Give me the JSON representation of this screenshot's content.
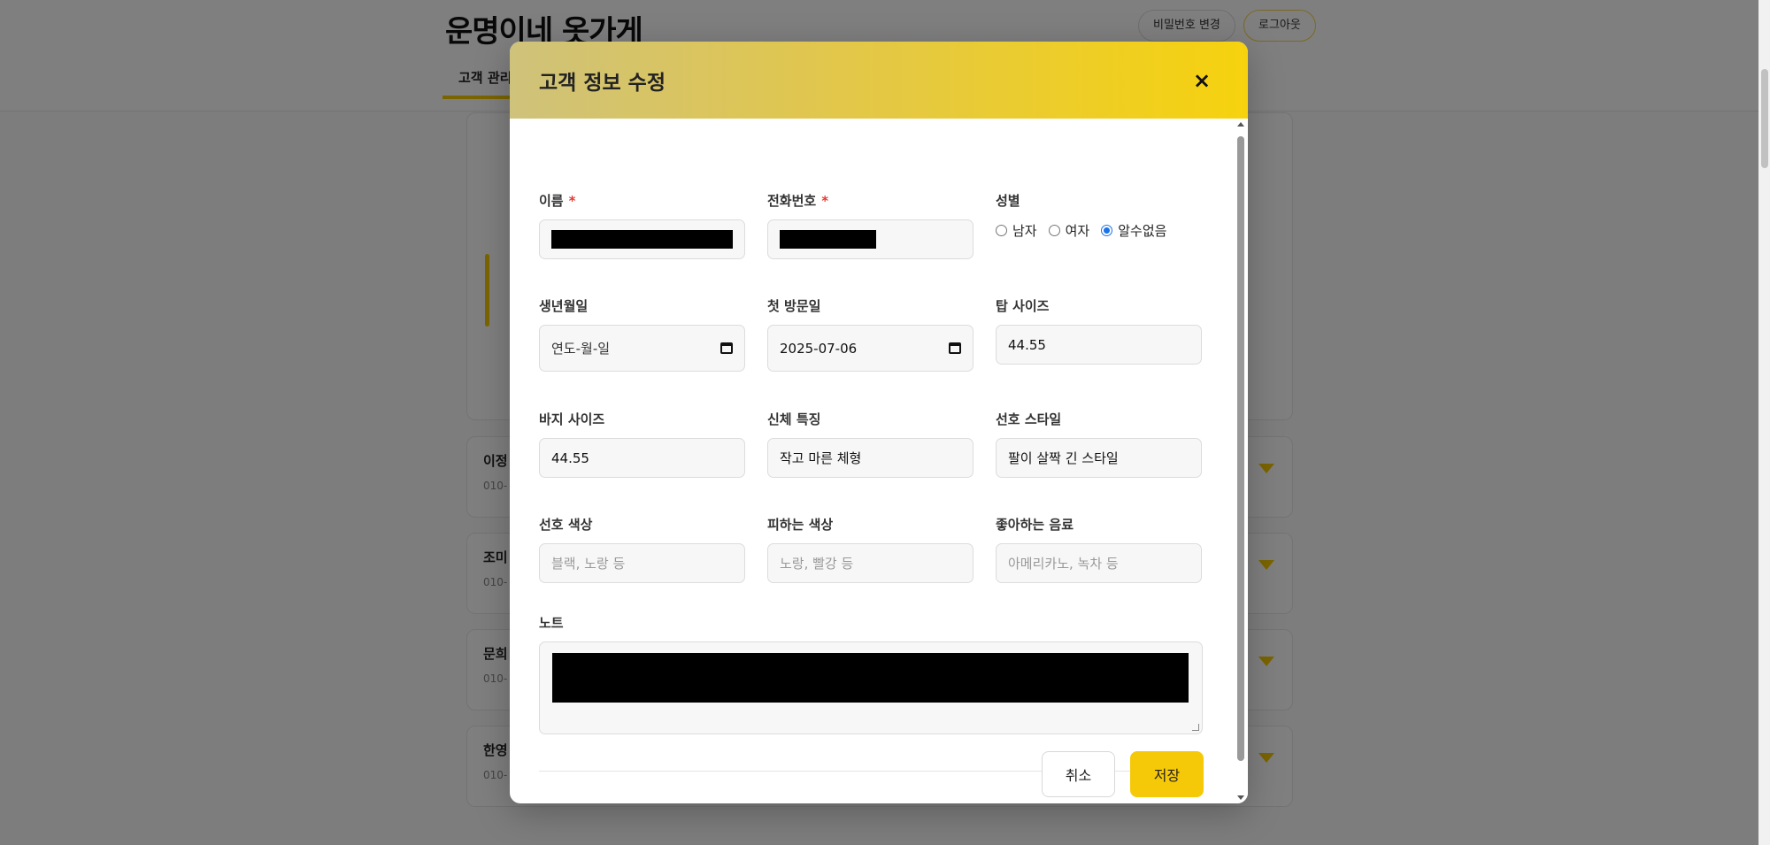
{
  "background": {
    "logo": "운명이네 옷가게",
    "header_buttons": [
      "비밀번호 변경",
      "로그아웃"
    ],
    "active_tab": "고객 관리",
    "cards": [
      {
        "title": "이정",
        "sub": "010-"
      },
      {
        "title": "조미",
        "sub": "010-"
      },
      {
        "title": "문희",
        "sub": "010-"
      },
      {
        "title": "한영",
        "sub": "010-"
      }
    ]
  },
  "modal": {
    "title": "고객 정보 수정",
    "close_icon": "×",
    "fields": {
      "name": {
        "label": "이름",
        "required_mark": "*"
      },
      "phone": {
        "label": "전화번호",
        "required_mark": "*"
      },
      "gender": {
        "label": "성별",
        "options": [
          "남자",
          "여자",
          "알수없음"
        ],
        "selected": "알수없음"
      },
      "birthday": {
        "label": "생년월일",
        "placeholder": "연도-월-일"
      },
      "first_visit": {
        "label": "첫 방문일",
        "value": "2025-07-06"
      },
      "top_size": {
        "label": "탑 사이즈",
        "value": "44.55"
      },
      "pants_size": {
        "label": "바지 사이즈",
        "value": "44.55"
      },
      "body_feature": {
        "label": "신체 특징",
        "value": "작고 마른 체형"
      },
      "preferred_style": {
        "label": "선호 스타일",
        "value": "팔이 살짝 긴 스타일"
      },
      "preferred_color": {
        "label": "선호 색상",
        "placeholder": "블랙, 노랑 등"
      },
      "avoided_color": {
        "label": "피하는 색상",
        "placeholder": "노랑, 빨강 등"
      },
      "favorite_drink": {
        "label": "좋아하는 음료",
        "placeholder": "아메리카노, 녹차 등"
      },
      "note": {
        "label": "노트"
      }
    },
    "buttons": {
      "cancel": "취소",
      "save": "저장"
    }
  },
  "colors": {
    "accent": "#f6c908",
    "header_gradient_start": "#cfc27a",
    "required": "#e53935"
  }
}
